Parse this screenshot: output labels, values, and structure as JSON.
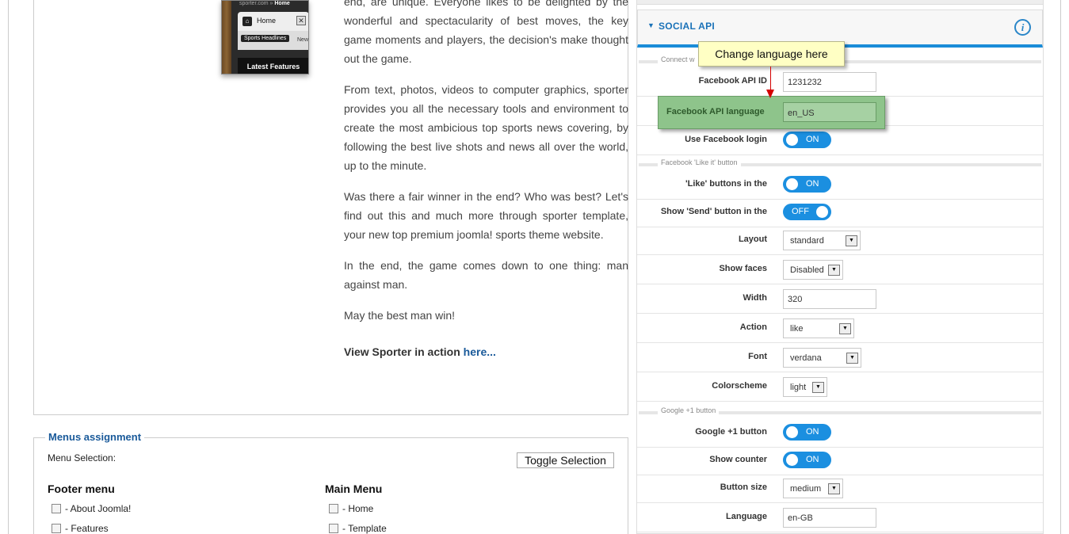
{
  "thumbnail": {
    "url_text": "sporter.com »",
    "url_current": "Home",
    "home_label": "Home",
    "chip_label": "Sports Headlines",
    "new_label": "New",
    "latest_label": "Latest Features"
  },
  "article": {
    "paragraphs": [
      "end, are unique. Everyone likes to be delighted by the wonderful and spectacularity of best moves, the key game moments and players, the decision's make thought out the game.",
      "From text, photos, videos to computer graphics, sporter provides you all the necessary tools and environment to create the most ambicious top sports news covering, by following the best live shots and news all over the world, up to the minute.",
      "Was there a fair winner in the end? Who was best? Let's find out this and much more through sporter template, your new top premium joomla! sports theme website.",
      "In the end, the game comes down to one thing: man against man.",
      "May the best man win!"
    ],
    "view_prefix": "View Sporter in action",
    "view_link": "here..."
  },
  "menus": {
    "legend": "Menus assignment",
    "selection_label": "Menu Selection:",
    "toggle_button": "Toggle Selection",
    "columns": [
      {
        "title": "Footer menu",
        "items": [
          "- About Joomla!",
          "- Features"
        ]
      },
      {
        "title": "Main Menu",
        "items": [
          "- Home",
          "- Template"
        ]
      }
    ]
  },
  "social": {
    "title": "SOCIAL API",
    "tooltip": "Change language here",
    "sections": {
      "connect": "Connect w",
      "like": "Facebook 'Like it' button",
      "google": "Google +1 button"
    },
    "facebook_api_id": {
      "label": "Facebook API ID",
      "value": "1231232"
    },
    "facebook_api_language": {
      "label": "Facebook API language",
      "value": "en_US"
    },
    "use_facebook_login": {
      "label": "Use Facebook login",
      "state": "ON"
    },
    "like_buttons": {
      "label": "'Like' buttons in the",
      "state": "ON"
    },
    "show_send": {
      "label": "Show 'Send' button in the",
      "state": "OFF"
    },
    "layout": {
      "label": "Layout",
      "value": "standard"
    },
    "show_faces": {
      "label": "Show faces",
      "value": "Disabled"
    },
    "width": {
      "label": "Width",
      "value": "320"
    },
    "action": {
      "label": "Action",
      "value": "like"
    },
    "font": {
      "label": "Font",
      "value": "verdana"
    },
    "colorscheme": {
      "label": "Colorscheme",
      "value": "light"
    },
    "google_plus_one": {
      "label": "Google +1 button",
      "state": "ON"
    },
    "show_counter": {
      "label": "Show counter",
      "state": "ON"
    },
    "button_size": {
      "label": "Button size",
      "value": "medium"
    },
    "language": {
      "label": "Language",
      "value": "en-GB"
    }
  },
  "colors": {
    "accent": "#1b8fe0",
    "link": "#1a5a9a",
    "highlight": "#8ec48b",
    "tooltip_bg": "#ffffc4",
    "arrow": "#d40000"
  }
}
